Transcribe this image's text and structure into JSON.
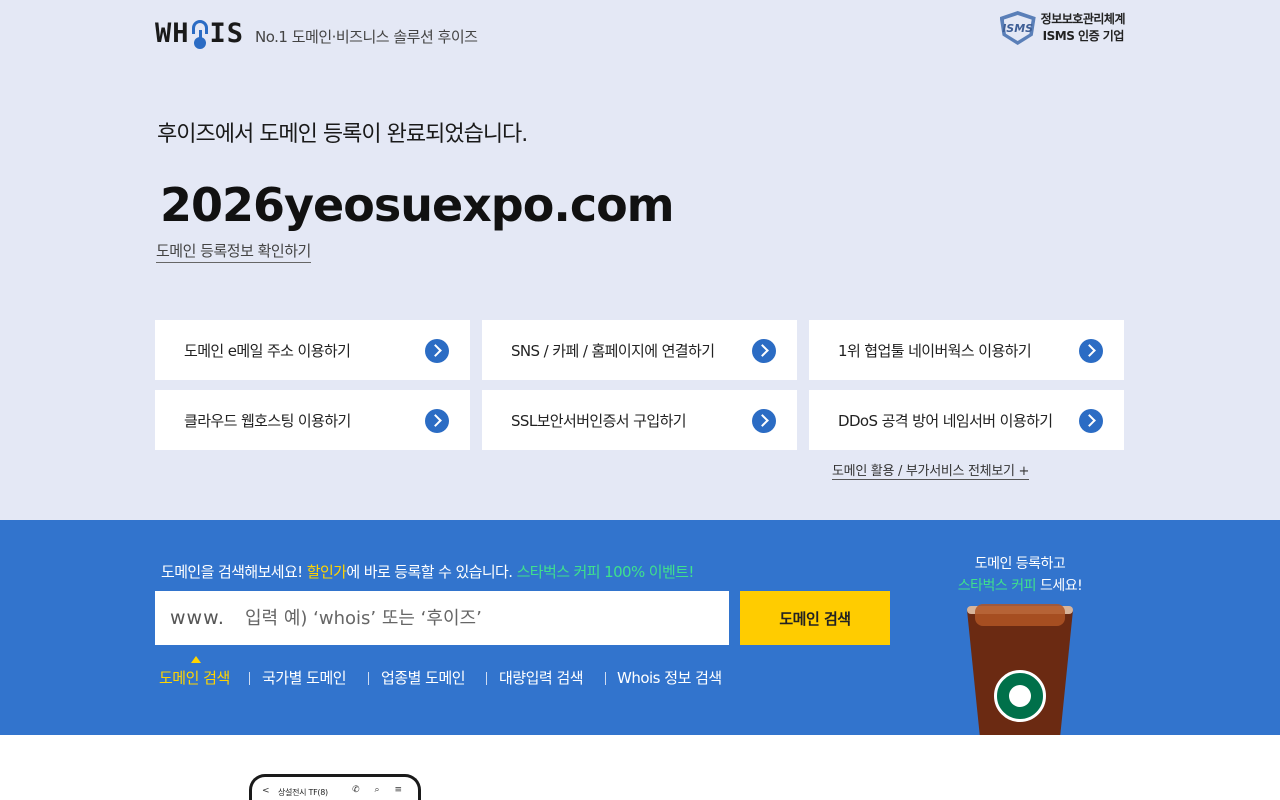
{
  "header": {
    "logo": "WH?IS",
    "tagline": "No.1 도메인·비즈니스 솔루션 후이즈",
    "isms_badge": "ISMS",
    "isms_line1": "정보보호관리체계",
    "isms_line2": "ISMS 인증 기업"
  },
  "result": {
    "message": "후이즈에서 도메인 등록이 완료되었습니다.",
    "domain": "2026yeosuexpo.com",
    "info_link": "도메인 등록정보 확인하기"
  },
  "services": [
    {
      "label": "도메인 e메일 주소 이용하기"
    },
    {
      "label": "SNS / 카페 / 홈페이지에 연결하기"
    },
    {
      "label": "1위 협업툴 네이버웍스 이용하기"
    },
    {
      "label": "클라우드 웹호스팅 이용하기"
    },
    {
      "label": "SSL보안서버인증서 구입하기"
    },
    {
      "label": "DDoS 공격 방어 네임서버 이용하기"
    }
  ],
  "all_services_link": "도메인 활용 / 부가서비스 전체보기 +",
  "search": {
    "promo_part1": "도메인을 검색해보세요! ",
    "promo_highlight1": "할인가",
    "promo_part2": "에 바로 등록할 수 있습니다. ",
    "promo_highlight2": "스타벅스 커피 100% 이벤트!",
    "prefix": "www.",
    "placeholder": "입력 예) ‘whois’ 또는 ‘후이즈’",
    "value": "",
    "button": "도메인 검색",
    "tabs": [
      "도메인 검색",
      "국가별 도메인",
      "업종별 도메인",
      "대량입력 검색",
      "Whois 정보 검색"
    ],
    "active_tab": "도메인 검색"
  },
  "side_promo": {
    "line1": "도메인 등록하고",
    "highlight": "스타벅스 커피",
    "line2_suffix": " 드세요!"
  },
  "phone_preview": {
    "back": "<",
    "title": "상설전시 TF(8)",
    "icons": "✆ ⌕ ≡"
  },
  "colors": {
    "top_background": "#e4e8f5",
    "search_band": "#3274cd",
    "accent_blue": "#2b6cc4",
    "button_yellow": "#ffcc00",
    "highlight_yellow": "#ffd400",
    "highlight_green": "#3fe08d"
  }
}
